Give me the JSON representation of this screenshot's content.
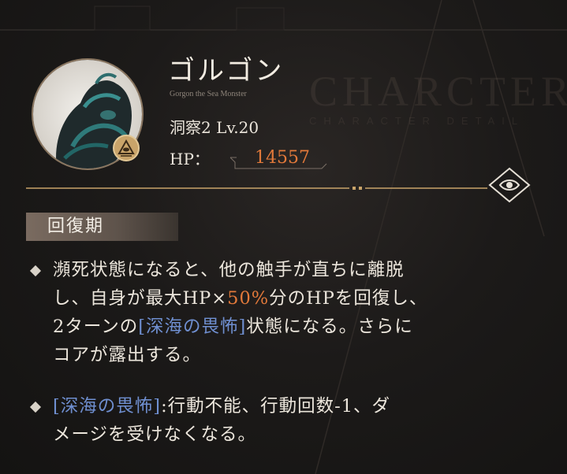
{
  "watermark": {
    "title": "CHARCTER",
    "subtitle": "CHARACTER DETAIL"
  },
  "enemy": {
    "name": "ゴルゴン",
    "subname": "Gorgon the Sea Monster",
    "level": "洞察2 Lv.20",
    "hp_label": "HP：",
    "hp_value": "14557"
  },
  "section": {
    "title": "回復期"
  },
  "entries": [
    {
      "line1": "瀕死状態になると、他の触手が直ちに離脱",
      "line2_a": "し、自身が最大HP×",
      "line2_b": "50%",
      "line2_c": "分のHPを回復し、",
      "line3_a": "2ターンの",
      "line3_b": "[深海の畏怖]",
      "line3_c": "状態になる。さらに",
      "line4": "コアが露出する。"
    },
    {
      "line1_a": "[深海の畏怖]",
      "line1_b": ":行動不能、行動回数-1、ダ",
      "line2": "メージを受けなくなる。"
    }
  ],
  "colors": {
    "accent_orange": "#e2793a",
    "accent_blue": "#6f8fd0",
    "gold": "#c9a46a"
  },
  "icons": {
    "rank_badge": "pyramid-eye-icon",
    "info_button": "eye-icon"
  }
}
